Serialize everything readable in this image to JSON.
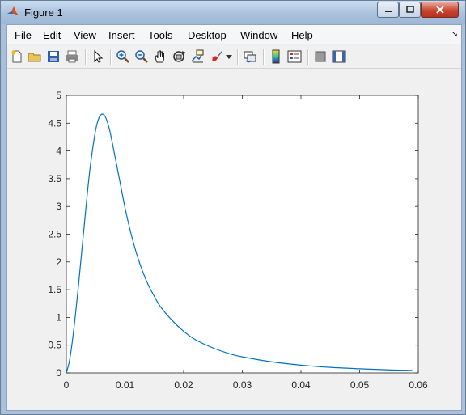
{
  "window": {
    "title": "Figure 1"
  },
  "menu": [
    {
      "label": "File"
    },
    {
      "label": "Edit"
    },
    {
      "label": "View"
    },
    {
      "label": "Insert"
    },
    {
      "label": "Tools"
    },
    {
      "label": "Desktop"
    },
    {
      "label": "Window"
    },
    {
      "label": "Help"
    }
  ],
  "toolbar": {
    "icons": [
      "new-figure-icon",
      "open-file-icon",
      "save-icon",
      "print-icon",
      "pointer-icon",
      "zoom-in-icon",
      "zoom-out-icon",
      "pan-icon",
      "rotate-3d-icon",
      "data-cursor-icon",
      "brush-icon",
      "link-plot-icon",
      "colorbar-icon",
      "legend-icon",
      "hide-plot-tools-icon",
      "show-plot-tools-icon"
    ]
  },
  "colors": {
    "line": "#0072BD",
    "axes": "#262626"
  },
  "chart_data": {
    "type": "line",
    "title": "",
    "xlabel": "",
    "ylabel": "",
    "xlim": [
      0,
      0.06
    ],
    "ylim": [
      0,
      5
    ],
    "xticks": [
      "0",
      "0.01",
      "0.02",
      "0.03",
      "0.04",
      "0.05",
      "0.06"
    ],
    "yticks": [
      "0",
      "0.5",
      "1",
      "1.5",
      "2",
      "2.5",
      "3",
      "3.5",
      "4",
      "4.5",
      "5"
    ],
    "grid": false,
    "series": [
      {
        "x": [
          0,
          0.0005,
          0.001,
          0.0015,
          0.002,
          0.0025,
          0.003,
          0.0035,
          0.004,
          0.0045,
          0.005,
          0.0055,
          0.006,
          0.0065,
          0.007,
          0.0075,
          0.008,
          0.009,
          0.01,
          0.011,
          0.012,
          0.013,
          0.014,
          0.015,
          0.016,
          0.018,
          0.02,
          0.022,
          0.025,
          0.028,
          0.03,
          0.035,
          0.04,
          0.045,
          0.05,
          0.055,
          0.059
        ],
        "y": [
          0,
          0.2,
          0.55,
          1.0,
          1.5,
          2.05,
          2.6,
          3.15,
          3.65,
          4.05,
          4.38,
          4.58,
          4.66,
          4.64,
          4.52,
          4.32,
          4.06,
          3.52,
          2.98,
          2.52,
          2.14,
          1.83,
          1.58,
          1.38,
          1.2,
          0.95,
          0.75,
          0.6,
          0.45,
          0.34,
          0.29,
          0.2,
          0.14,
          0.1,
          0.075,
          0.055,
          0.045
        ]
      }
    ]
  }
}
